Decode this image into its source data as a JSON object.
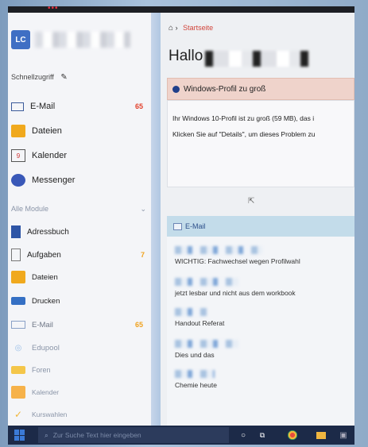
{
  "top": {
    "dots": "•••"
  },
  "user": {
    "initials": "LC"
  },
  "sidebar": {
    "quick_access_title": "Schnellzugriff",
    "quick": [
      {
        "label": "E-Mail",
        "badge": "65",
        "icon": "mail-icon"
      },
      {
        "label": "Dateien",
        "badge": "",
        "icon": "folder-icon"
      },
      {
        "label": "Kalender",
        "badge": "",
        "icon": "calendar-icon",
        "icon_text": "9"
      },
      {
        "label": "Messenger",
        "badge": "",
        "icon": "messenger-icon"
      }
    ],
    "modules_title": "Alle Module",
    "modules": [
      {
        "label": "Adressbuch",
        "badge": "",
        "icon": "addressbook-icon"
      },
      {
        "label": "Aufgaben",
        "badge": "7",
        "icon": "tasks-icon"
      },
      {
        "label": "Dateien",
        "badge": "",
        "icon": "folder-icon"
      },
      {
        "label": "Drucken",
        "badge": "",
        "icon": "printer-icon"
      },
      {
        "label": "E-Mail",
        "badge": "65",
        "icon": "mail-icon"
      },
      {
        "label": "Edupool",
        "badge": "",
        "icon": "edupool-icon"
      },
      {
        "label": "Foren",
        "badge": "",
        "icon": "forum-icon"
      },
      {
        "label": "Kalender",
        "badge": "",
        "icon": "calendar-icon"
      },
      {
        "label": "Kurswahlen",
        "badge": "",
        "icon": "checkmark-icon"
      }
    ],
    "badge_color": "#e2402b"
  },
  "main": {
    "breadcrumb": "Startseite",
    "greeting": "Hallo",
    "alert": {
      "title": "Windows-Profil zu groß",
      "line1": "Ihr Windows 10-Profil ist zu groß (59 MB), das i",
      "line2": "Klicken Sie auf \"Details\", um dieses Problem zu"
    },
    "mail_panel": {
      "title": "E-Mail",
      "items": [
        {
          "subject": "WICHTIG: Fachwechsel wegen Profilwahl"
        },
        {
          "subject": "jetzt lesbar und nicht aus dem workbook"
        },
        {
          "subject": "Handout Referat"
        },
        {
          "subject": "Dies und das"
        },
        {
          "subject": "Chemie heute"
        }
      ]
    }
  },
  "taskbar": {
    "search_placeholder": "Zur Suche Text hier eingeben"
  }
}
